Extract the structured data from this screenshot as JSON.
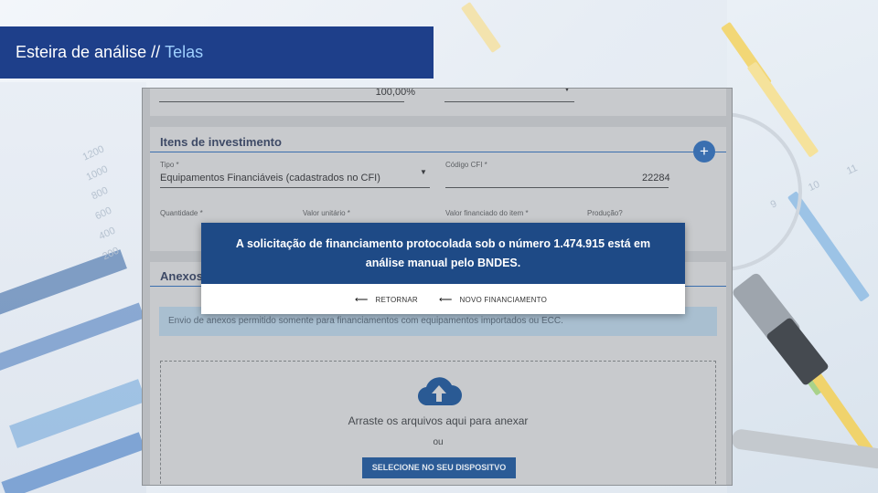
{
  "banner": {
    "title_main": "Esteira de análise //",
    "title_accent": "Telas"
  },
  "form": {
    "percent_value": "100,00%",
    "section_investimentos": "Itens de investimento",
    "add_label": "+",
    "tipo_label": "Tipo *",
    "tipo_value": "Equipamentos Financiáveis (cadastrados no CFI)",
    "codigo_label": "Código CFI *",
    "codigo_value": "22284",
    "quantidade_label": "Quantidade *",
    "valor_unitario_label": "Valor unitário *",
    "valor_financiado_label": "Valor financiado do item *",
    "producao_label": "Produção?",
    "section_anexos": "Anexos",
    "info_text": "Envio de anexos permitido somente para financiamentos com equipamentos importados ou ECC.",
    "drop_text": "Arraste os arquivos aqui para anexar",
    "ou_text": "ou",
    "device_button": "SELECIONE NO SEU DISPOSITVO"
  },
  "modal": {
    "message_line1": "A solicitação de financiamento protocolada sob o número 1.474.915 está em",
    "message_line2": "análise manual pelo BNDES.",
    "retornar": "RETORNAR",
    "novo": "NOVO FINANCIAMENTO"
  },
  "background": {
    "numbers": [
      "200",
      "400",
      "600",
      "800",
      "1000",
      "1200",
      "9",
      "10",
      "11"
    ]
  },
  "colors": {
    "banner": "#1e3f8a",
    "accent": "#9fd0ff",
    "modal_header": "#1e4a86"
  }
}
